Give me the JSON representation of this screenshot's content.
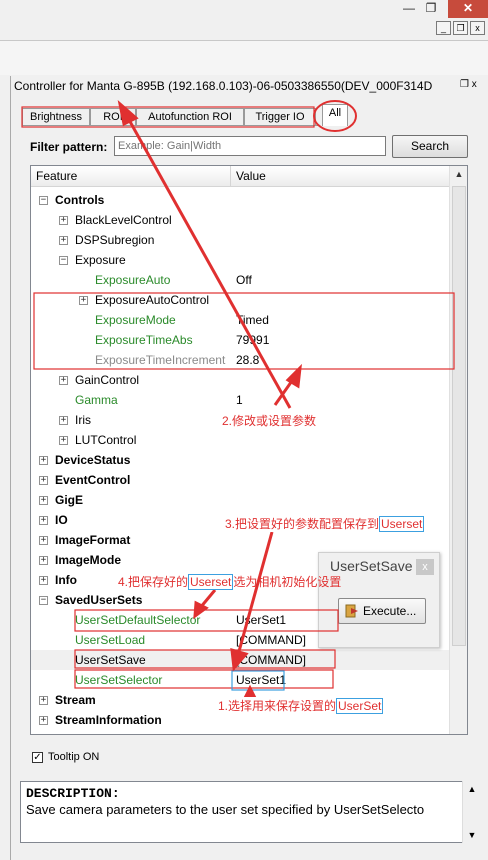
{
  "window": {
    "min_icon": "minimize-icon",
    "max_icon": "maximize-icon",
    "close_glyph": "✕",
    "mdi_min": "_",
    "mdi_restore": "❐",
    "mdi_close": "x"
  },
  "panel": {
    "title": "Controller for Manta G-895B (192.168.0.103)-06-0503386550(DEV_000F314D",
    "title_btns": "❐ x"
  },
  "tabs": [
    {
      "label": "Brightness"
    },
    {
      "label": "ROI"
    },
    {
      "label": "Autofunction ROI"
    },
    {
      "label": "Trigger IO"
    },
    {
      "label": "All"
    }
  ],
  "filter": {
    "label": "Filter pattern:",
    "placeholder": "Example: Gain|Width",
    "search_label": "Search"
  },
  "grid": {
    "col_feature": "Feature",
    "col_value": "Value",
    "rows": [
      {
        "feature": "Controls",
        "value": ""
      },
      {
        "feature": "BlackLevelControl",
        "value": ""
      },
      {
        "feature": "DSPSubregion",
        "value": ""
      },
      {
        "feature": "Exposure",
        "value": ""
      },
      {
        "feature": "ExposureAuto",
        "value": "Off"
      },
      {
        "feature": "ExposureAutoControl",
        "value": ""
      },
      {
        "feature": "ExposureMode",
        "value": "Timed"
      },
      {
        "feature": "ExposureTimeAbs",
        "value": "79991"
      },
      {
        "feature": "ExposureTimeIncrement",
        "value": "28.8"
      },
      {
        "feature": "GainControl",
        "value": ""
      },
      {
        "feature": "Gamma",
        "value": "1"
      },
      {
        "feature": "Iris",
        "value": ""
      },
      {
        "feature": "LUTControl",
        "value": ""
      },
      {
        "feature": "DeviceStatus",
        "value": ""
      },
      {
        "feature": "EventControl",
        "value": ""
      },
      {
        "feature": "GigE",
        "value": ""
      },
      {
        "feature": "IO",
        "value": ""
      },
      {
        "feature": "ImageFormat",
        "value": ""
      },
      {
        "feature": "ImageMode",
        "value": ""
      },
      {
        "feature": "Info",
        "value": ""
      },
      {
        "feature": "SavedUserSets",
        "value": ""
      },
      {
        "feature": "UserSetDefaultSelector",
        "value": "UserSet1"
      },
      {
        "feature": "UserSetLoad",
        "value": "[COMMAND]"
      },
      {
        "feature": "UserSetSave",
        "value": "[COMMAND]"
      },
      {
        "feature": "UserSetSelector",
        "value": "UserSet1"
      },
      {
        "feature": "Stream",
        "value": ""
      },
      {
        "feature": "StreamInformation",
        "value": ""
      }
    ]
  },
  "tooltip": {
    "label": "Tooltip ON",
    "check": "✓"
  },
  "description": {
    "title": "DESCRIPTION:",
    "text": "Save camera parameters to the user set specified by UserSetSelecto"
  },
  "popup": {
    "title": "UserSetSave",
    "close": "x",
    "execute_label": "Execute..."
  },
  "annotations": {
    "a1_prefix": "1.选择用来保存设置的",
    "a1_word": "UserSet",
    "a2": "2.修改或设置参数",
    "a3_prefix": "3.把设置好的参数配置保存到",
    "a3_word": "Userset",
    "a4_prefix": "4.把保存好的",
    "a4_word": "Userset",
    "a4_suffix": "选为相机初始化设置"
  },
  "colors": {
    "annotation": "#e03030",
    "highlight_box": "#3ca0e0",
    "feature_green": "#2a8a2a"
  }
}
